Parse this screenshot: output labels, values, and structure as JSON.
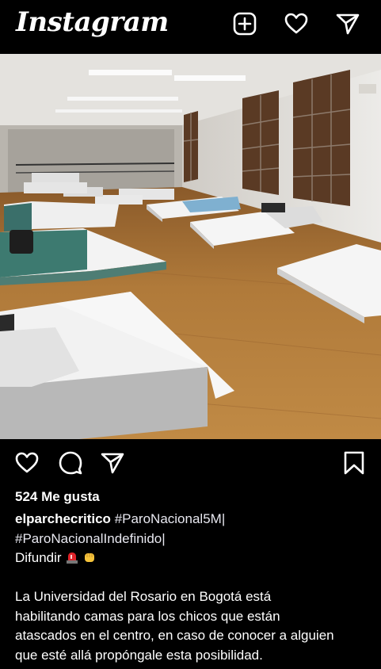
{
  "header": {
    "logo_text": "Instagram",
    "icons": [
      "add-post-icon",
      "heart-icon",
      "direct-message-icon"
    ]
  },
  "post": {
    "image_alt_icon": "photo-dormitory-beds",
    "likes_text": "524 Me gusta",
    "username": "elparchecritico",
    "hashtag1": "#ParoNacional5M|",
    "hashtag2": "#ParoNacionalIndefinido|",
    "caption_word": "Difundir",
    "emojis": [
      "siren-emoji",
      "fist-emoji"
    ],
    "body_line1": "La Universidad del Rosario en Bogotá está",
    "body_line2": "habilitando camas para los chicos que están",
    "body_line3": "atascados en el centro,  en caso de conocer a alguien",
    "body_line4": "que esté allá propóngale esta posibilidad."
  },
  "actions": [
    "like-icon",
    "comment-icon",
    "share-icon",
    "bookmark-icon"
  ],
  "colors": {
    "background": "#000000",
    "text": "#ffffff",
    "floor": "#b07a3a",
    "wall": "#e9e7e3"
  }
}
